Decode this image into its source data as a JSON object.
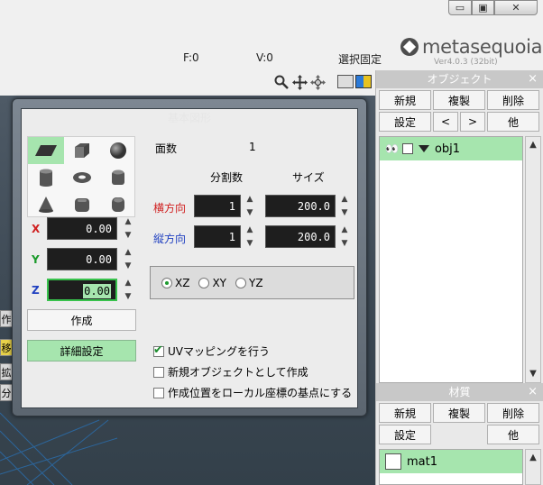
{
  "window": {
    "minimize": "▭",
    "maximize": "▣",
    "close": "✕"
  },
  "status": {
    "faces": "F:0",
    "vertices": "V:0",
    "selection_lock": "選択固定"
  },
  "logo": {
    "name": "metasequoia",
    "number": "4",
    "version": "Ver4.0.3 (32bit)"
  },
  "viewport": {
    "side_tabs": [
      "作",
      "移",
      "拡",
      "分"
    ]
  },
  "object_panel": {
    "title": "オブジェクト",
    "close": "×",
    "buttons_row1": [
      "新規",
      "複製",
      "削除"
    ],
    "buttons_row2": [
      "設定",
      "<",
      ">",
      "他"
    ],
    "items": [
      {
        "eyes": "👀",
        "name": "obj1"
      }
    ]
  },
  "material_panel": {
    "title": "材質",
    "close": "×",
    "buttons_row1": [
      "新規",
      "複製",
      "削除"
    ],
    "buttons_row2": [
      "設定",
      "",
      "他"
    ],
    "items": [
      {
        "name": "mat1"
      }
    ]
  },
  "dialog": {
    "title": "基本図形",
    "shapes": [
      "plane",
      "cube",
      "sphere",
      "cylinder",
      "torus",
      "rounded-cylinder",
      "cone",
      "rounded-cube",
      "capsule"
    ],
    "selected_shape": "plane",
    "x_label": "X",
    "x_value": "0.00",
    "y_label": "Y",
    "y_value": "0.00",
    "z_label": "Z",
    "z_value": "0.00",
    "create_label": "作成",
    "detail_label": "詳細設定",
    "faces_label": "面数",
    "faces_value": "1",
    "divisions_header": "分割数",
    "size_header": "サイズ",
    "horizontal_label": "横方向",
    "horizontal_div": "1",
    "horizontal_size": "200.0",
    "vertical_label": "縦方向",
    "vertical_div": "1",
    "vertical_size": "200.0",
    "planes": [
      "XZ",
      "XY",
      "YZ"
    ],
    "selected_plane": "XZ",
    "uv_mapping": "UVマッピングを行う",
    "uv_mapping_checked": true,
    "as_new_object": "新規オブジェクトとして作成",
    "as_new_object_checked": false,
    "local_origin": "作成位置をローカル座標の基点にする",
    "local_origin_checked": false,
    "colors": {
      "x": "#d02020",
      "y": "#1a9a2a",
      "z": "#2040c0",
      "accent_green": "#a6e5ae"
    }
  }
}
